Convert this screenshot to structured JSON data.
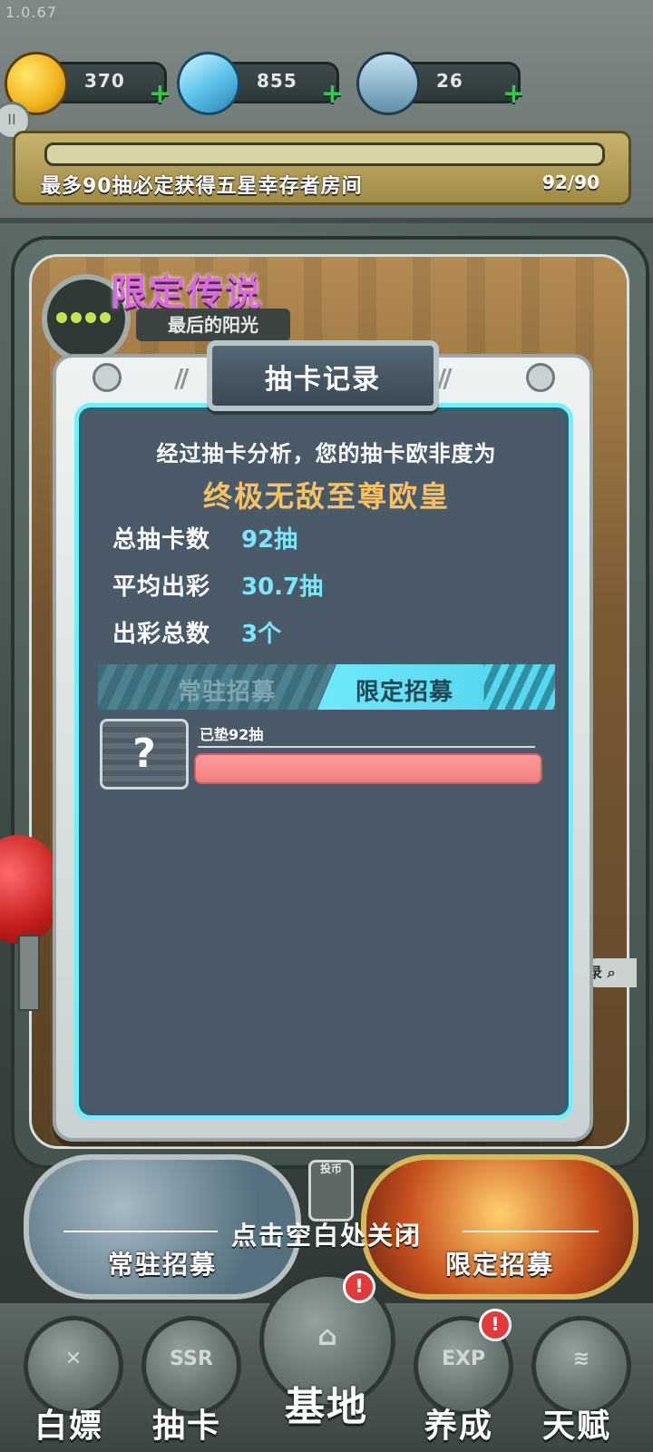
{
  "app": {
    "version": "1.0.67"
  },
  "resources": [
    {
      "icon": "coin-icon",
      "value": "370"
    },
    {
      "icon": "gem-icon",
      "value": "855"
    },
    {
      "icon": "battery-icon",
      "value": "26"
    }
  ],
  "progress": {
    "text": "最多90抽必定获得五星幸存者房间",
    "count": "92/90"
  },
  "banner": {
    "title": "限定传说",
    "subtitle": "最后的阳光"
  },
  "modal": {
    "title": "抽卡记录",
    "analysis": "经过抽卡分析，您的抽卡欧非度为",
    "rank": "终极无敌至尊欧皇",
    "stats": [
      {
        "label": "总抽卡数",
        "value": "92抽"
      },
      {
        "label": "平均出彩",
        "value": "30.7抽"
      },
      {
        "label": "出彩总数",
        "value": "3个"
      }
    ],
    "tabs": {
      "regular": "常驻招募",
      "limited": "限定招募"
    },
    "record": {
      "icon": "?",
      "label": "已垫92抽"
    },
    "close_hint": "点击空白处关闭"
  },
  "side_label": "录",
  "coin_slot": "投币",
  "bottom_banners": {
    "regular": "常驻招募",
    "limited": "限定招募"
  },
  "nav": [
    {
      "label": "白嫖",
      "icon": "x-ticket-icon",
      "badge": ""
    },
    {
      "label": "抽卡",
      "icon": "ssr-icon",
      "badge": ""
    },
    {
      "label": "基地",
      "icon": "base-icon",
      "badge": "!"
    },
    {
      "label": "养成",
      "icon": "exp-icon",
      "badge": "!"
    },
    {
      "label": "天赋",
      "icon": "dna-icon",
      "badge": ""
    }
  ],
  "nav_icon_text": {
    "ssr": "SSR",
    "exp": "EXP"
  },
  "colors": {
    "accent": "#6ff1ff",
    "rank": "#f6c265",
    "value": "#7ee7ff",
    "bar": "#f07f7f"
  }
}
